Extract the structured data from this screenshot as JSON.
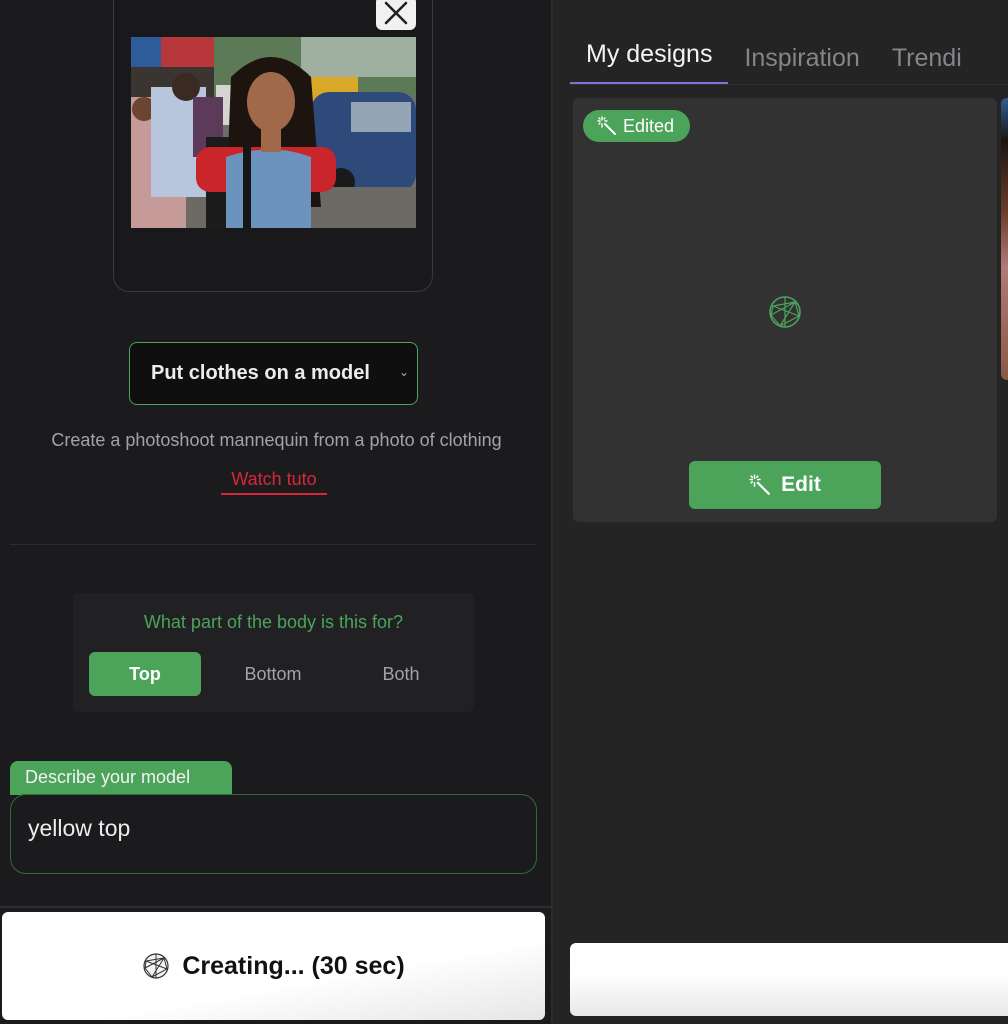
{
  "upload": {
    "image_alt": "Woman in blue top and red sleeves standing on a city street",
    "close_icon": "close-icon"
  },
  "mode_select": {
    "value": "Put clothes on a model",
    "chevron": "⌄"
  },
  "description": "Create a photoshoot mannequin from a photo of clothing",
  "watch_tuto": "Watch tuto",
  "body_part": {
    "question": "What part of the body is this for?",
    "options": [
      "Top",
      "Bottom",
      "Both"
    ],
    "selected": "Top"
  },
  "model_description": {
    "label": "Describe your model",
    "value": "yellow top"
  },
  "create_button": {
    "label": "Creating... (30 sec)"
  },
  "tabs": [
    "My designs",
    "Inspiration",
    "Trendi"
  ],
  "active_tab": "My designs",
  "design_card": {
    "badge": "Edited",
    "edit_label": "Edit"
  },
  "colors": {
    "accent_green": "#4ca35a",
    "link_red": "#d6273a",
    "tab_indicator": "#7b74d8"
  }
}
